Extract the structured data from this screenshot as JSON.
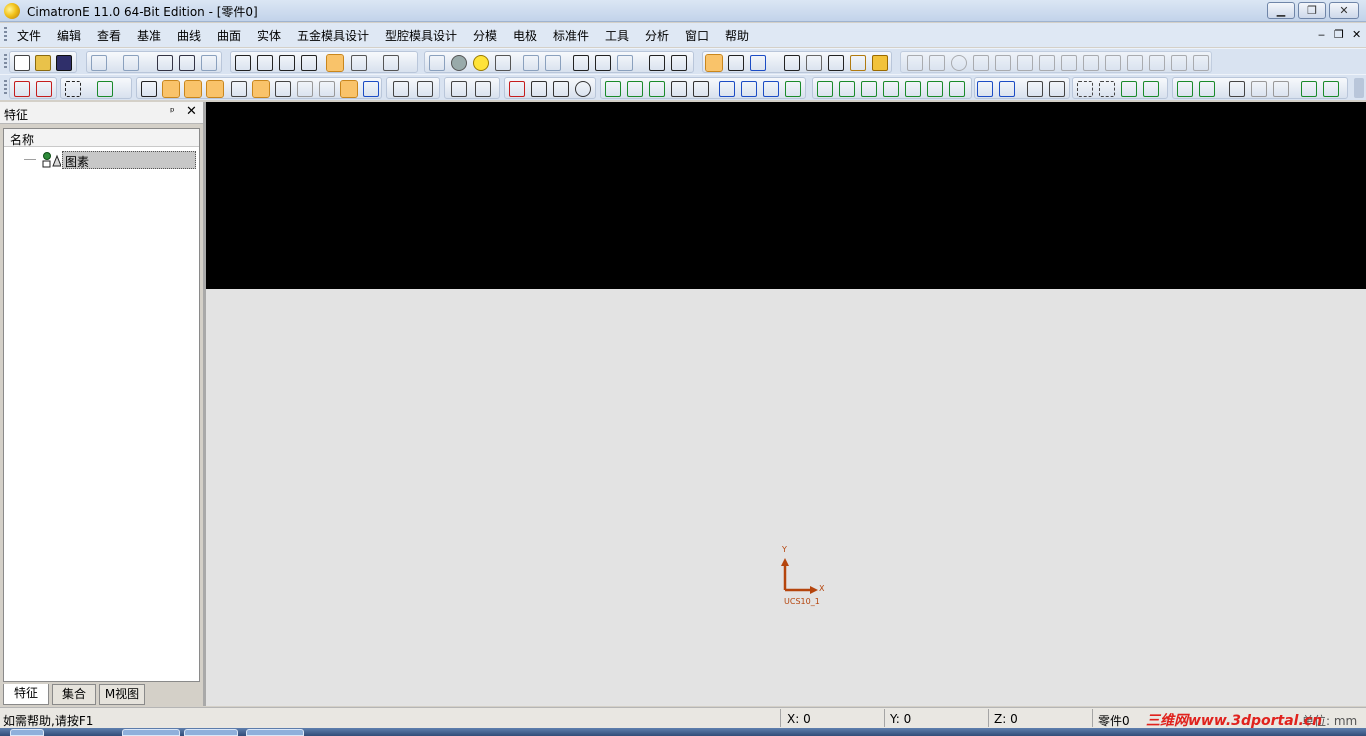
{
  "window": {
    "title": "CimatronE 11.0 64-Bit Edition - [零件0]",
    "minimize_glyph": "▁",
    "maximize_glyph": "❐",
    "close_glyph": "✕"
  },
  "menu": {
    "items": [
      "文件",
      "编辑",
      "查看",
      "基准",
      "曲线",
      "曲面",
      "实体",
      "五金模具设计",
      "型腔模具设计",
      "分模",
      "电极",
      "标准件",
      "工具",
      "分析",
      "窗口",
      "帮助"
    ],
    "mdi_minimize": "‒",
    "mdi_restore": "❐",
    "mdi_close": "✕"
  },
  "feature_panel": {
    "title": "特征",
    "pin_glyph": "ᵖ",
    "close_glyph": "✕",
    "column_header": "名称",
    "tree": [
      {
        "label": "图素"
      }
    ],
    "tabs": [
      "特征",
      "集合",
      "M视图"
    ]
  },
  "viewport": {
    "ucs_label": "UCS10_1",
    "axis_x": "X",
    "axis_y": "Y",
    "ucs_color": "#b5450d"
  },
  "statusbar": {
    "help": "如需帮助,请按F1",
    "x": "X: 0",
    "y": "Y: 0",
    "z": "Z: 0",
    "part": "零件0",
    "unit": "单位: mm",
    "watermark": "三维网www.3dportal.cn"
  }
}
